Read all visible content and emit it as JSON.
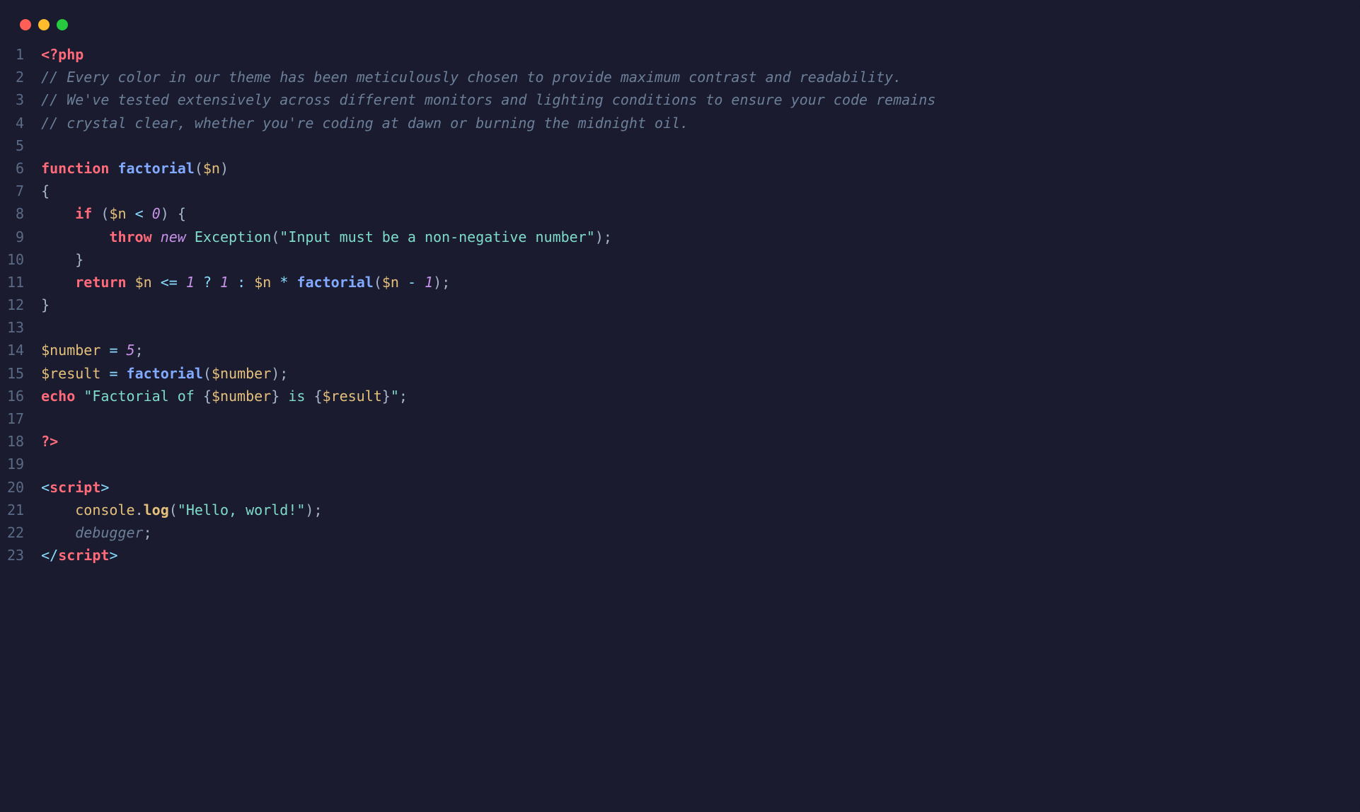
{
  "trafficLights": [
    "red",
    "yellow",
    "green"
  ],
  "colors": {
    "background": "#1a1b2e",
    "gutter": "#5b6b86",
    "phpTag": "#ff6b7a",
    "comment": "#6b7f99",
    "keyword": "#ff6b7a",
    "keywordItalic": "#c792ea",
    "function": "#82aaff",
    "className": "#7fdbca",
    "variable": "#e5c07b",
    "string": "#7fdbca",
    "number": "#c792ea",
    "operator": "#89ddff",
    "punctuation": "#a6b5cc"
  },
  "lineCount": 23,
  "lines": [
    {
      "n": 1,
      "tokens": [
        {
          "t": "<?php",
          "c": "php-tag"
        }
      ]
    },
    {
      "n": 2,
      "tokens": [
        {
          "t": "// Every color in our theme has been meticulously chosen to provide maximum contrast and readability.",
          "c": "comment"
        }
      ]
    },
    {
      "n": 3,
      "tokens": [
        {
          "t": "// We've tested extensively across different monitors and lighting conditions to ensure your code remains",
          "c": "comment"
        }
      ]
    },
    {
      "n": 4,
      "tokens": [
        {
          "t": "// crystal clear, whether you're coding at dawn or burning the midnight oil.",
          "c": "comment"
        }
      ]
    },
    {
      "n": 5,
      "tokens": []
    },
    {
      "n": 6,
      "tokens": [
        {
          "t": "function",
          "c": "keyword"
        },
        {
          "t": " ",
          "c": ""
        },
        {
          "t": "factorial",
          "c": "func-name"
        },
        {
          "t": "(",
          "c": "punct"
        },
        {
          "t": "$n",
          "c": "variable"
        },
        {
          "t": ")",
          "c": "punct"
        }
      ]
    },
    {
      "n": 7,
      "tokens": [
        {
          "t": "{",
          "c": "brace"
        }
      ]
    },
    {
      "n": 8,
      "tokens": [
        {
          "t": "    ",
          "c": ""
        },
        {
          "t": "if",
          "c": "keyword"
        },
        {
          "t": " ",
          "c": ""
        },
        {
          "t": "(",
          "c": "punct"
        },
        {
          "t": "$n",
          "c": "variable"
        },
        {
          "t": " ",
          "c": ""
        },
        {
          "t": "<",
          "c": "operator"
        },
        {
          "t": " ",
          "c": ""
        },
        {
          "t": "0",
          "c": "number"
        },
        {
          "t": ")",
          "c": "punct"
        },
        {
          "t": " ",
          "c": ""
        },
        {
          "t": "{",
          "c": "brace"
        }
      ]
    },
    {
      "n": 9,
      "tokens": [
        {
          "t": "        ",
          "c": ""
        },
        {
          "t": "throw",
          "c": "keyword"
        },
        {
          "t": " ",
          "c": ""
        },
        {
          "t": "new",
          "c": "keyword-it"
        },
        {
          "t": " ",
          "c": ""
        },
        {
          "t": "Exception",
          "c": "class-name"
        },
        {
          "t": "(",
          "c": "punct"
        },
        {
          "t": "\"Input must be a non-negative number\"",
          "c": "string"
        },
        {
          "t": ")",
          "c": "punct"
        },
        {
          "t": ";",
          "c": "punct"
        }
      ]
    },
    {
      "n": 10,
      "tokens": [
        {
          "t": "    ",
          "c": ""
        },
        {
          "t": "}",
          "c": "brace"
        }
      ]
    },
    {
      "n": 11,
      "tokens": [
        {
          "t": "    ",
          "c": ""
        },
        {
          "t": "return",
          "c": "keyword"
        },
        {
          "t": " ",
          "c": ""
        },
        {
          "t": "$n",
          "c": "variable"
        },
        {
          "t": " ",
          "c": ""
        },
        {
          "t": "<=",
          "c": "operator"
        },
        {
          "t": " ",
          "c": ""
        },
        {
          "t": "1",
          "c": "number"
        },
        {
          "t": " ",
          "c": ""
        },
        {
          "t": "?",
          "c": "operator"
        },
        {
          "t": " ",
          "c": ""
        },
        {
          "t": "1",
          "c": "number"
        },
        {
          "t": " ",
          "c": ""
        },
        {
          "t": ":",
          "c": "operator"
        },
        {
          "t": " ",
          "c": ""
        },
        {
          "t": "$n",
          "c": "variable"
        },
        {
          "t": " ",
          "c": ""
        },
        {
          "t": "*",
          "c": "operator"
        },
        {
          "t": " ",
          "c": ""
        },
        {
          "t": "factorial",
          "c": "func-name"
        },
        {
          "t": "(",
          "c": "punct"
        },
        {
          "t": "$n",
          "c": "variable"
        },
        {
          "t": " ",
          "c": ""
        },
        {
          "t": "-",
          "c": "operator"
        },
        {
          "t": " ",
          "c": ""
        },
        {
          "t": "1",
          "c": "number"
        },
        {
          "t": ")",
          "c": "punct"
        },
        {
          "t": ";",
          "c": "punct"
        }
      ]
    },
    {
      "n": 12,
      "tokens": [
        {
          "t": "}",
          "c": "brace"
        }
      ]
    },
    {
      "n": 13,
      "tokens": []
    },
    {
      "n": 14,
      "tokens": [
        {
          "t": "$number",
          "c": "variable"
        },
        {
          "t": " ",
          "c": ""
        },
        {
          "t": "=",
          "c": "operator"
        },
        {
          "t": " ",
          "c": ""
        },
        {
          "t": "5",
          "c": "number"
        },
        {
          "t": ";",
          "c": "punct"
        }
      ]
    },
    {
      "n": 15,
      "tokens": [
        {
          "t": "$result",
          "c": "variable"
        },
        {
          "t": " ",
          "c": ""
        },
        {
          "t": "=",
          "c": "operator"
        },
        {
          "t": " ",
          "c": ""
        },
        {
          "t": "factorial",
          "c": "func-name"
        },
        {
          "t": "(",
          "c": "punct"
        },
        {
          "t": "$number",
          "c": "variable"
        },
        {
          "t": ")",
          "c": "punct"
        },
        {
          "t": ";",
          "c": "punct"
        }
      ]
    },
    {
      "n": 16,
      "tokens": [
        {
          "t": "echo",
          "c": "keyword"
        },
        {
          "t": " ",
          "c": ""
        },
        {
          "t": "\"Factorial of ",
          "c": "string"
        },
        {
          "t": "{",
          "c": "punct"
        },
        {
          "t": "$number",
          "c": "string-interp"
        },
        {
          "t": "}",
          "c": "punct"
        },
        {
          "t": " is ",
          "c": "string"
        },
        {
          "t": "{",
          "c": "punct"
        },
        {
          "t": "$result",
          "c": "string-interp"
        },
        {
          "t": "}",
          "c": "punct"
        },
        {
          "t": "\"",
          "c": "string"
        },
        {
          "t": ";",
          "c": "punct"
        }
      ]
    },
    {
      "n": 17,
      "tokens": []
    },
    {
      "n": 18,
      "tokens": [
        {
          "t": "?>",
          "c": "php-tag"
        }
      ]
    },
    {
      "n": 19,
      "tokens": []
    },
    {
      "n": 20,
      "tokens": [
        {
          "t": "<",
          "c": "tag-pun"
        },
        {
          "t": "script",
          "c": "tag"
        },
        {
          "t": ">",
          "c": "tag-pun"
        }
      ]
    },
    {
      "n": 21,
      "tokens": [
        {
          "t": "    ",
          "c": ""
        },
        {
          "t": "console",
          "c": "obj"
        },
        {
          "t": ".",
          "c": "punct"
        },
        {
          "t": "log",
          "c": "prop"
        },
        {
          "t": "(",
          "c": "punct"
        },
        {
          "t": "\"Hello, world!\"",
          "c": "string"
        },
        {
          "t": ")",
          "c": "punct"
        },
        {
          "t": ";",
          "c": "punct"
        }
      ]
    },
    {
      "n": 22,
      "tokens": [
        {
          "t": "    ",
          "c": ""
        },
        {
          "t": "debugger",
          "c": "debugger"
        },
        {
          "t": ";",
          "c": "punct"
        }
      ]
    },
    {
      "n": 23,
      "tokens": [
        {
          "t": "</",
          "c": "tag-pun"
        },
        {
          "t": "script",
          "c": "tag"
        },
        {
          "t": ">",
          "c": "tag-pun"
        }
      ]
    }
  ]
}
